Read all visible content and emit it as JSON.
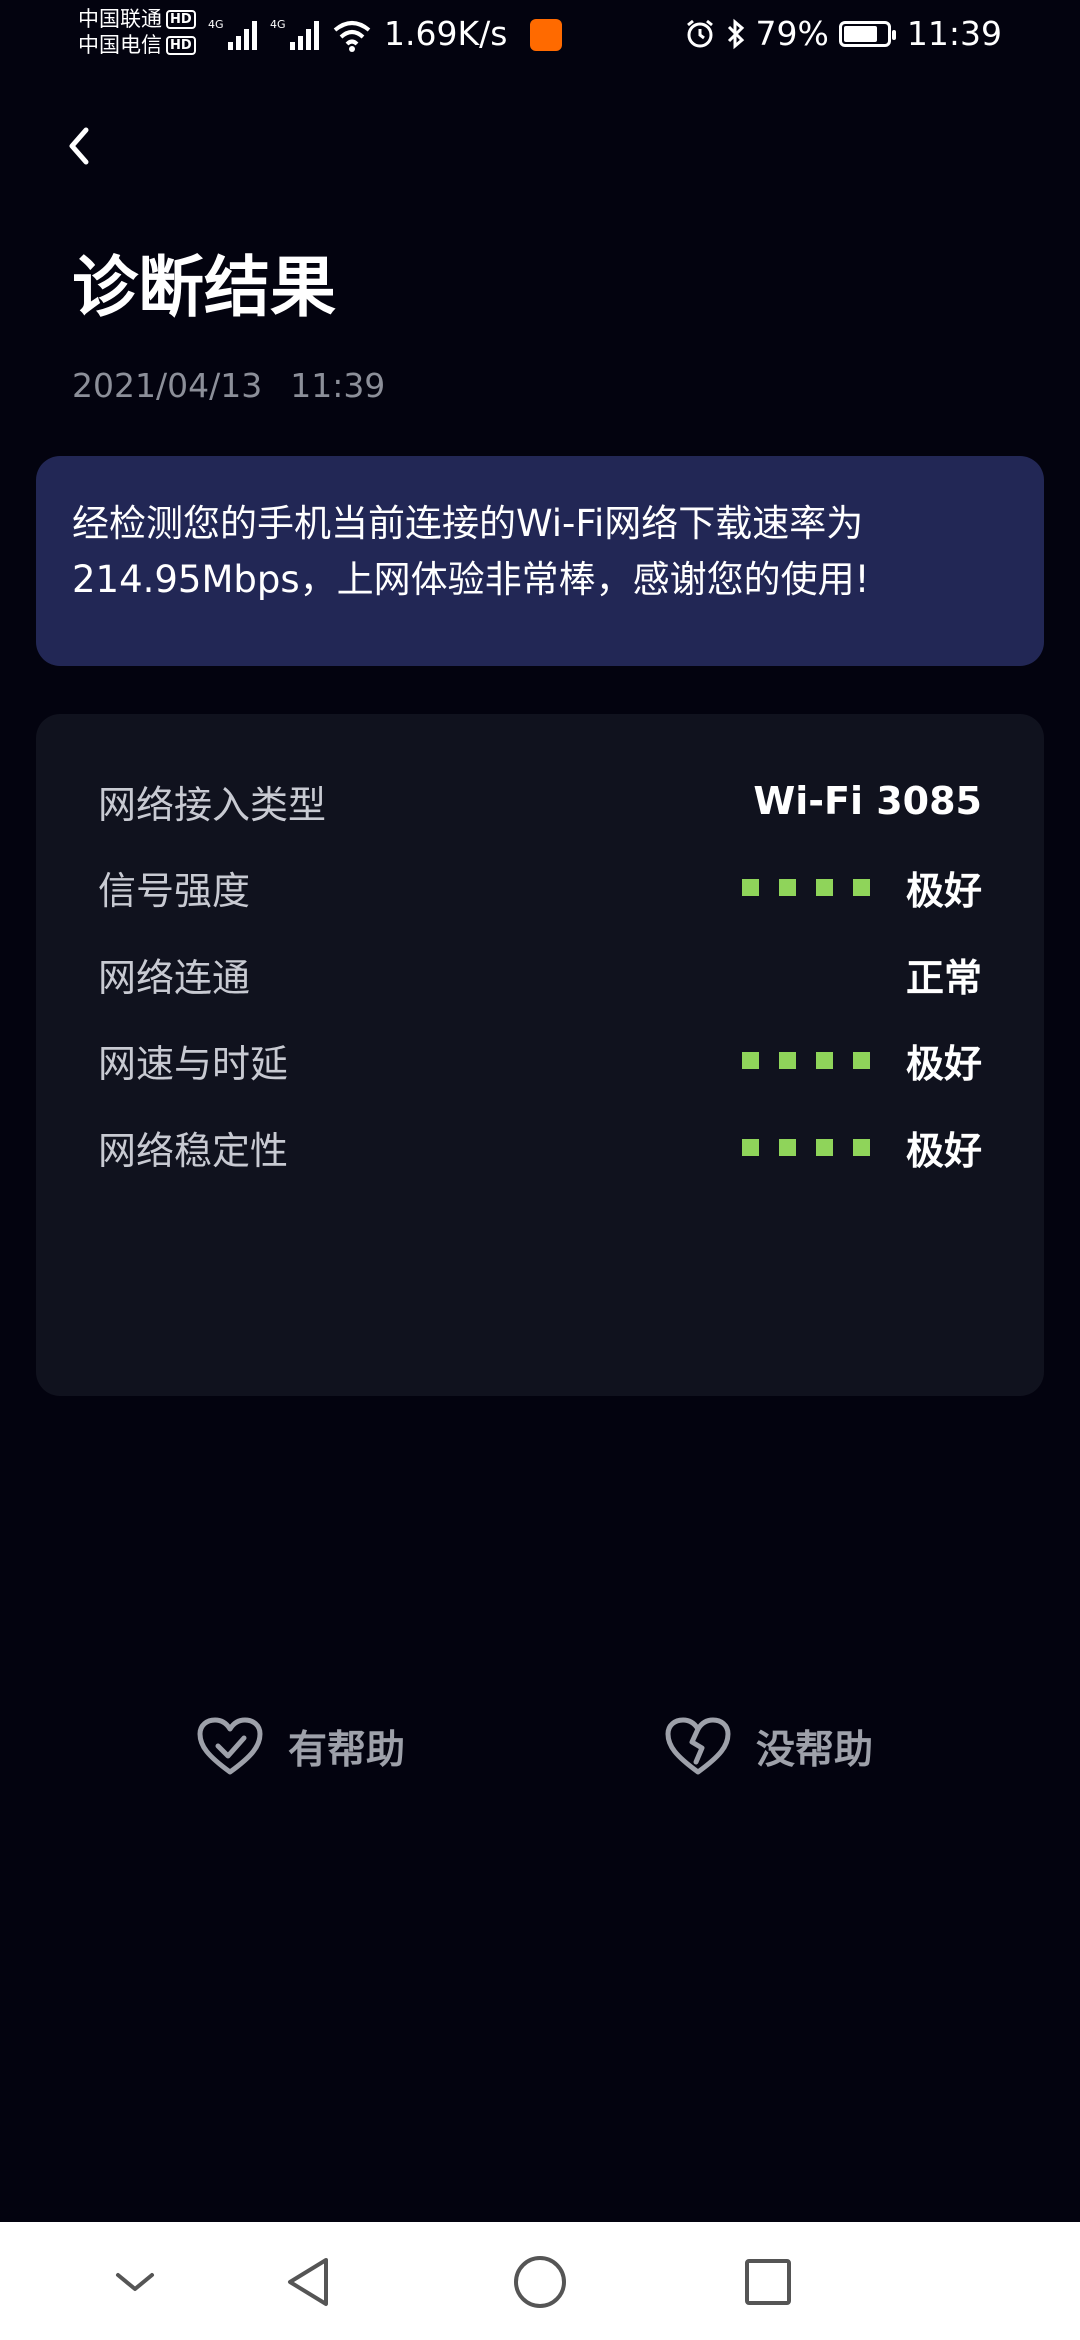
{
  "status_bar": {
    "carrier1": "中国联通",
    "carrier2": "中国电信",
    "hd": "HD",
    "net_type": "4G",
    "speed": "1.69K/s",
    "battery": "79%",
    "battery_level": 0.79,
    "time": "11:39"
  },
  "header": {
    "title": "诊断结果",
    "date": "2021/04/13",
    "time": "11:39"
  },
  "summary": {
    "text": "经检测您的手机当前连接的Wi-Fi网络下载速率为214.95Mbps，上网体验非常棒，感谢您的使用!"
  },
  "details": {
    "rows": [
      {
        "label": "网络接入类型",
        "value": "Wi-Fi 3085",
        "bars": 0
      },
      {
        "label": "信号强度",
        "value": "极好",
        "bars": 4
      },
      {
        "label": "网络连通",
        "value": "正常",
        "bars": 0
      },
      {
        "label": "网速与时延",
        "value": "极好",
        "bars": 4
      },
      {
        "label": "网络稳定性",
        "value": "极好",
        "bars": 4
      }
    ]
  },
  "feedback": {
    "helpful": "有帮助",
    "not_helpful": "没帮助",
    "helpful_icon": "heart-check-icon",
    "not_helpful_icon": "broken-heart-icon"
  },
  "colors": {
    "background": "#03030f",
    "summary_card": "#222755",
    "detail_card": "#10121e",
    "signal_green": "#8fd45a"
  }
}
